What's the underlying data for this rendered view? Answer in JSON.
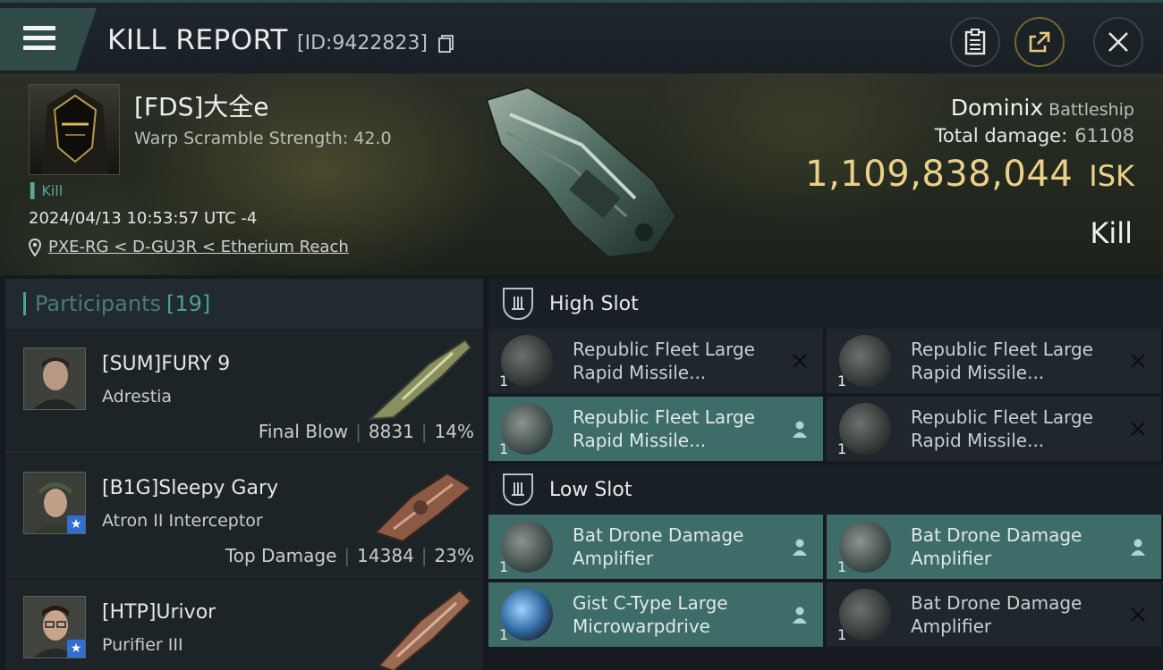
{
  "header": {
    "title": "KILL REPORT",
    "report_id": "[ID:9422823]"
  },
  "victim": {
    "name": "[FDS]大全e",
    "warp_scramble": "Warp Scramble Strength: 42.0",
    "kill_tag": "Kill",
    "timestamp": "2024/04/13 10:53:57 UTC -4",
    "location": "PXE-RG < D-GU3R < Etherium Reach",
    "ship_name": "Dominix",
    "ship_class": "Battleship",
    "total_damage_label": "Total damage:",
    "total_damage_value": "61108",
    "isk_value": "1,109,838,044",
    "isk_unit": "ISK",
    "outcome": "Kill"
  },
  "participants": {
    "label": "Participants",
    "count": "[19]",
    "rows": [
      {
        "name": "[SUM]FURY 9",
        "ship": "Adrestia",
        "role": "Final Blow",
        "damage": "8831",
        "percent": "14%",
        "badge": ""
      },
      {
        "name": "[B1G]Sleepy Gary",
        "ship": "Atron II Interceptor",
        "role": "Top Damage",
        "damage": "14384",
        "percent": "23%",
        "badge": "★"
      },
      {
        "name": "[HTP]Urivor",
        "ship": "Purifier III",
        "role": "",
        "damage": "",
        "percent": "",
        "badge": "★"
      }
    ]
  },
  "fitting": {
    "high_slot_label": "High Slot",
    "low_slot_label": "Low Slot",
    "high_slot": [
      {
        "name": "Republic Fleet Large Rapid Missile...",
        "qty": "1",
        "state": "destroyed"
      },
      {
        "name": "Republic Fleet Large Rapid Missile...",
        "qty": "1",
        "state": "destroyed"
      },
      {
        "name": "Republic Fleet Large Rapid Missile...",
        "qty": "1",
        "state": "dropped"
      },
      {
        "name": "Republic Fleet Large Rapid Missile...",
        "qty": "1",
        "state": "destroyed"
      }
    ],
    "low_slot": [
      {
        "name": "Bat Drone Damage Amplifier",
        "qty": "1",
        "state": "dropped"
      },
      {
        "name": "Bat Drone Damage Amplifier",
        "qty": "1",
        "state": "dropped"
      },
      {
        "name": "Gist C-Type Large Microwarpdrive",
        "qty": "1",
        "state": "dropped"
      },
      {
        "name": "Bat Drone Damage Amplifier",
        "qty": "1",
        "state": "destroyed"
      }
    ]
  },
  "colors": {
    "accent_teal": "#4aa09c",
    "isk_gold": "#ecd08a",
    "dropped_bg": "#3e6d69"
  }
}
